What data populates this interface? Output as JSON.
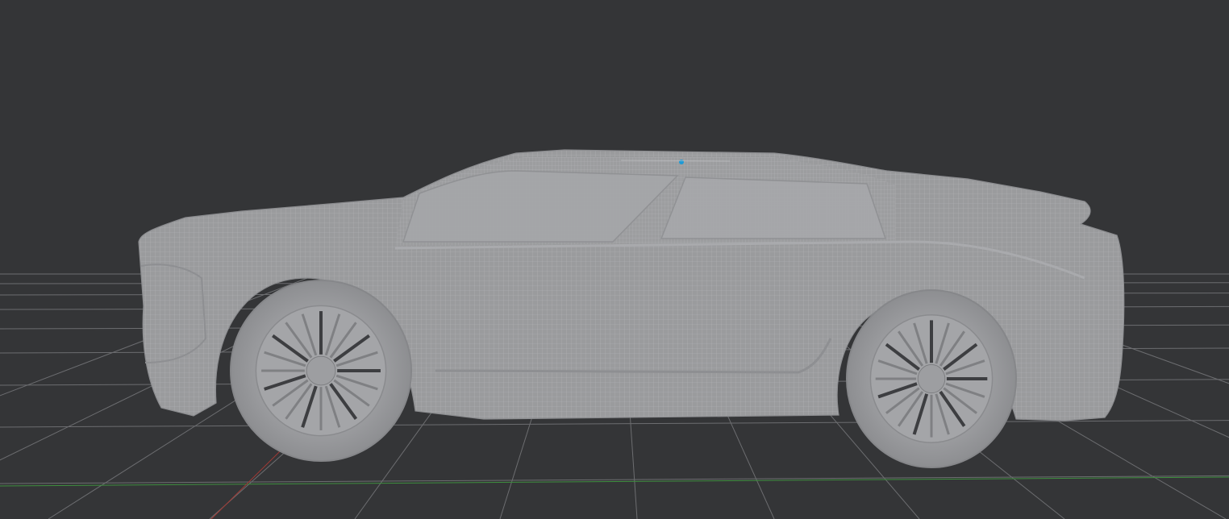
{
  "viewport": {
    "background": "#343537",
    "grid_color": "#6c6d70",
    "x_axis_color": "#3f8f3f",
    "y_axis_color": "#a13a35",
    "model_color": "#9b9c9e",
    "mesh_line_color": "#b4b5b8",
    "pivot_color": "#1e9ad6"
  },
  "scene": {
    "object_name": "car-mesh",
    "display_mode": "wireframe-on-shaded",
    "wheel_spokes": 20
  }
}
